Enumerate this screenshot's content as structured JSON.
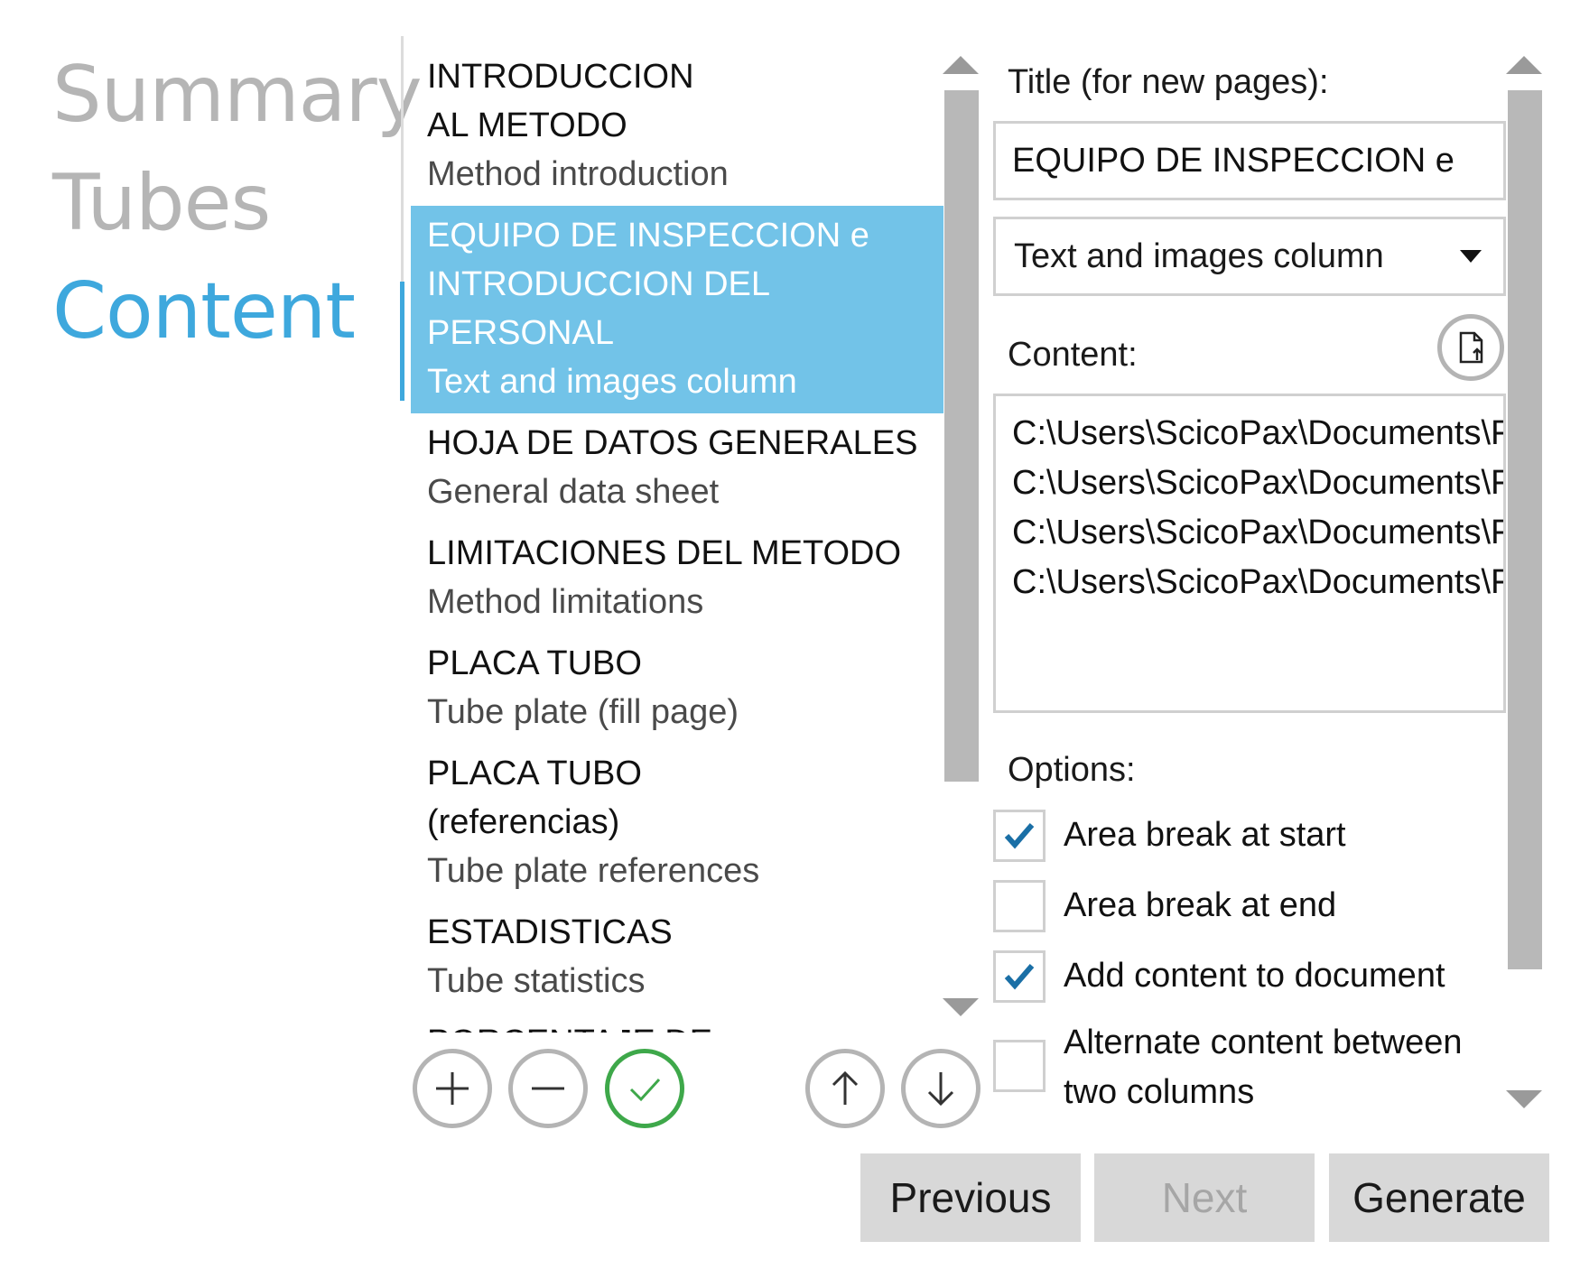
{
  "nav": {
    "items": [
      {
        "label": "Summary",
        "state": "inactive"
      },
      {
        "label": "Tubes",
        "state": "inactive"
      },
      {
        "label": "Content",
        "state": "active"
      }
    ]
  },
  "sections": {
    "items": [
      {
        "title": "INTRODUCCION AL METODO",
        "subtitle": "Method introduction",
        "selected": false
      },
      {
        "title": "EQUIPO DE INSPECCION e INTRODUCCION DEL PERSONAL",
        "subtitle": "Text and images column",
        "selected": true
      },
      {
        "title": "HOJA DE DATOS GENERALES",
        "subtitle": "General data sheet",
        "selected": false
      },
      {
        "title": "LIMITACIONES DEL METODO",
        "subtitle": "Method limitations",
        "selected": false
      },
      {
        "title": "PLACA TUBO",
        "subtitle": "Tube plate (fill page)",
        "selected": false
      },
      {
        "title": "PLACA TUBO (referencias)",
        "subtitle": "Tube plate references",
        "selected": false
      },
      {
        "title": "ESTADISTICAS",
        "subtitle": "Tube statistics",
        "selected": false
      },
      {
        "title": "PORCENTAJE DE",
        "subtitle": "",
        "selected": false
      }
    ],
    "actions": [
      "add-icon",
      "remove-icon",
      "check-icon",
      "arrow-up-icon",
      "arrow-down-icon"
    ]
  },
  "editor": {
    "title_label": "Title (for new pages):",
    "title_value": "EQUIPO DE INSPECCION e",
    "layout_selected": "Text and images column",
    "content_label": "Content:",
    "content_lines": [
      "C:\\Users\\ScicoPax\\Documents\\F",
      "C:\\Users\\ScicoPax\\Documents\\F",
      "C:\\Users\\ScicoPax\\Documents\\F",
      "C:\\Users\\ScicoPax\\Documents\\F"
    ],
    "options_label": "Options:",
    "options": [
      {
        "label": "Area break at start",
        "checked": true
      },
      {
        "label": "Area break at end",
        "checked": false
      },
      {
        "label": "Add content to document",
        "checked": true
      },
      {
        "label": "Alternate content between two columns",
        "checked": false
      }
    ]
  },
  "footer": {
    "previous": "Previous",
    "next": "Next",
    "generate": "Generate"
  },
  "colors": {
    "accent": "#3ea8dd",
    "selection": "#72c3e8",
    "check": "#1a6fa6",
    "confirm": "#3ea84a"
  }
}
